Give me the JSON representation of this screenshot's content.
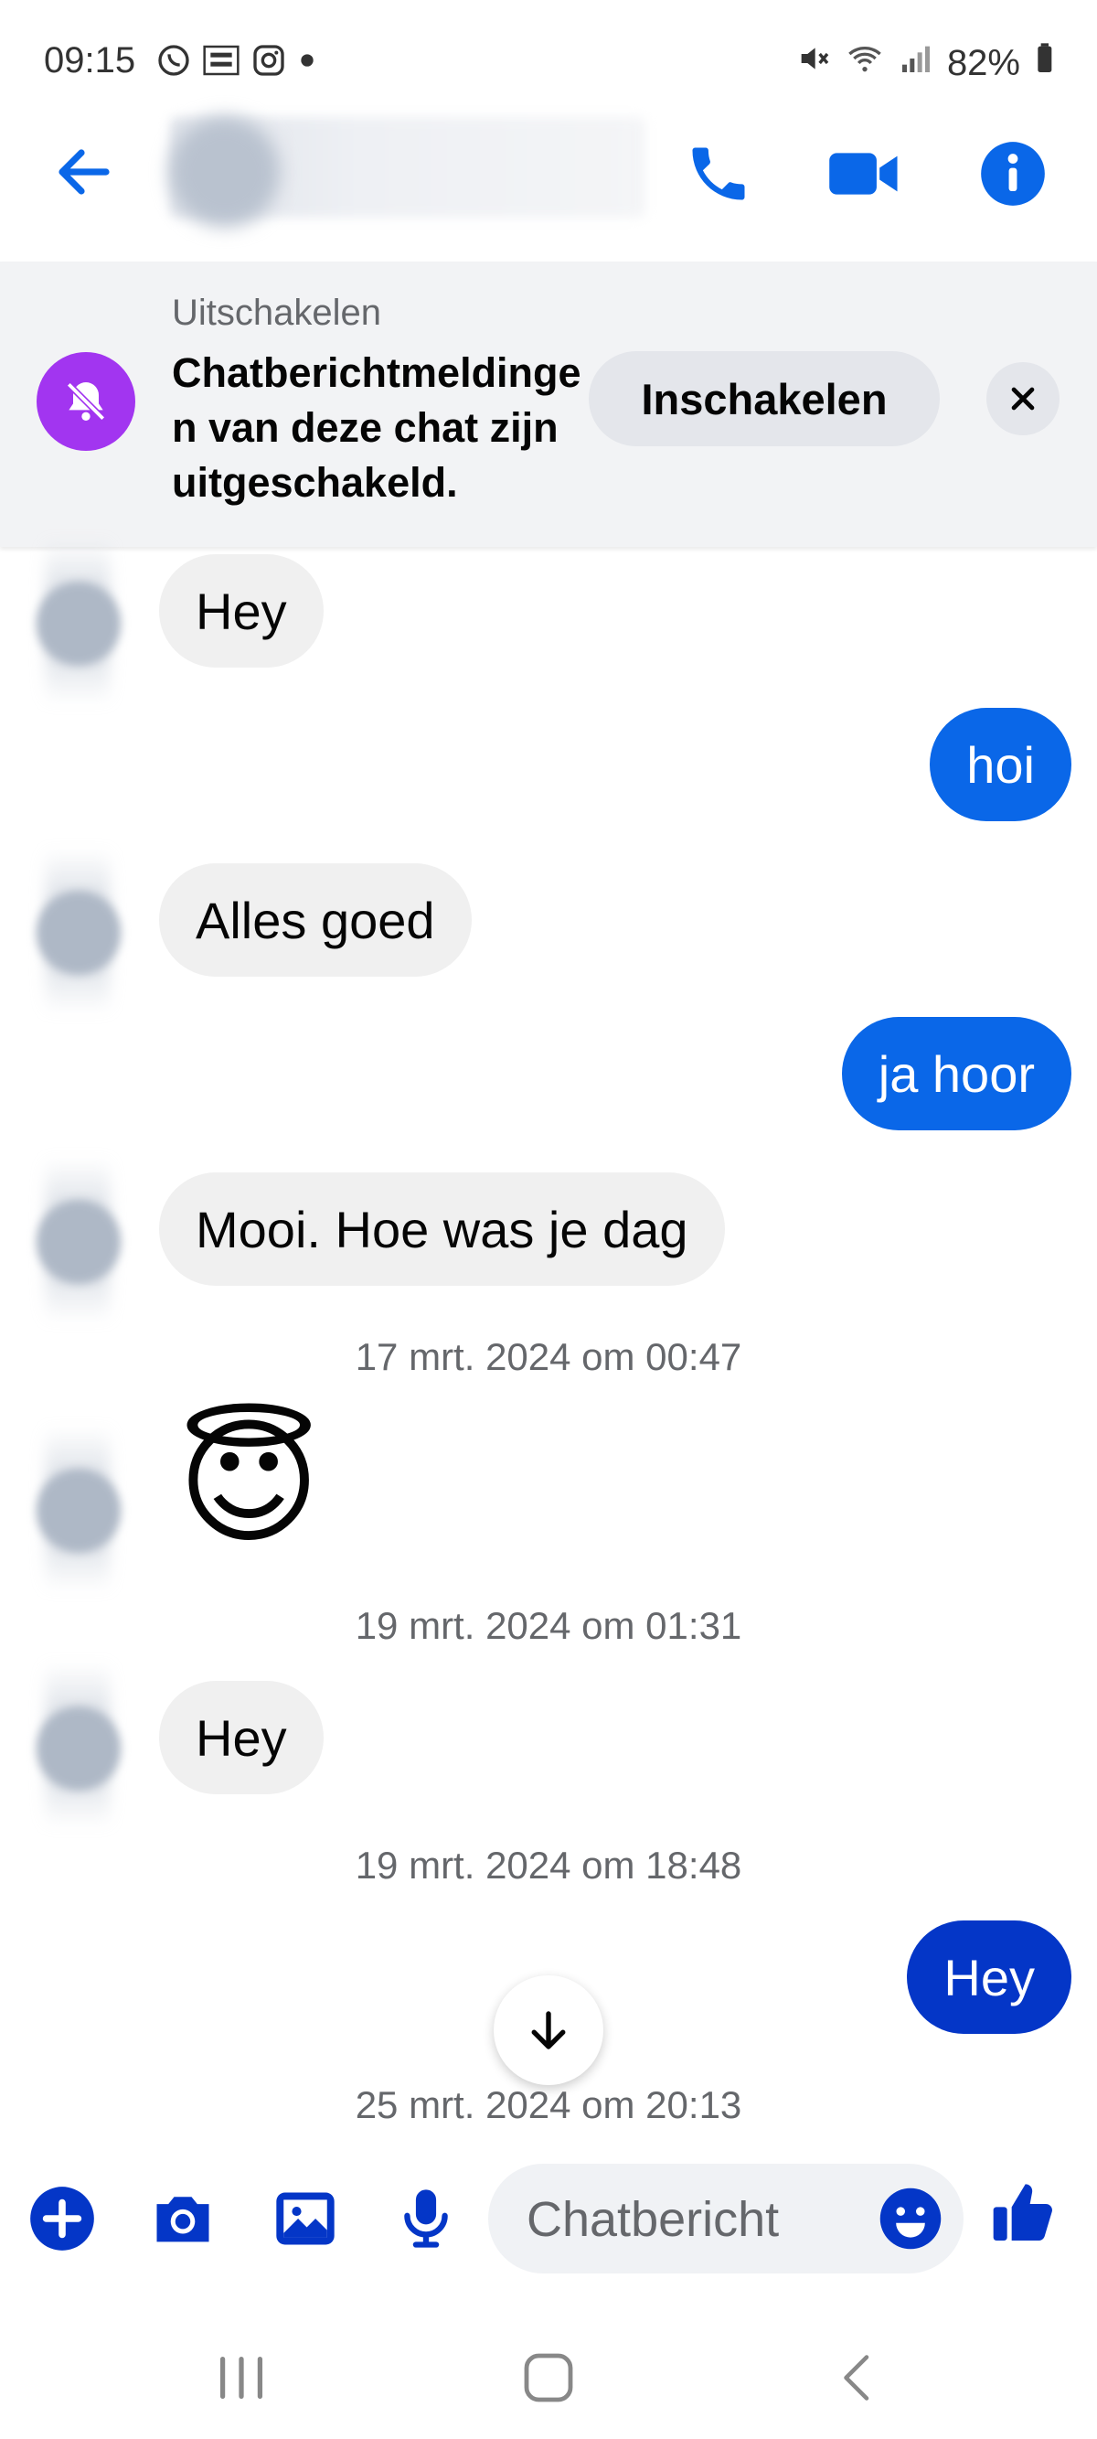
{
  "status_bar": {
    "time": "09:15",
    "battery": "82%",
    "icons": [
      "whatsapp-icon",
      "temu-icon",
      "instagram-icon",
      "dot-icon",
      "mute-icon",
      "wifi-icon",
      "signal-icon",
      "battery-icon"
    ]
  },
  "header": {
    "icons": [
      "back-arrow-icon",
      "phone-icon",
      "video-icon",
      "info-icon"
    ]
  },
  "banner": {
    "title": "Uitschakelen",
    "text": "Chatberichtmeldingen van deze chat zijn uitgeschakeld.",
    "button": "Inschakelen"
  },
  "messages": [
    {
      "side": "in",
      "text": "Hey"
    },
    {
      "side": "out",
      "text": "hoi"
    },
    {
      "side": "in",
      "text": "Alles goed"
    },
    {
      "side": "out",
      "text": "ja hoor"
    },
    {
      "side": "in",
      "text": "Mooi. Hoe was je dag"
    },
    {
      "side": "stamp",
      "text": "17 mrt. 2024 om 00:47"
    },
    {
      "side": "in",
      "text": "😇"
    },
    {
      "side": "stamp",
      "text": "19 mrt. 2024 om 01:31"
    },
    {
      "side": "in",
      "text": "Hey"
    },
    {
      "side": "stamp",
      "text": "19 mrt. 2024 om 18:48"
    },
    {
      "side": "out",
      "text": "Hey"
    },
    {
      "side": "stamp",
      "text": "25 mrt. 2024 om 20:13"
    }
  ],
  "composer": {
    "placeholder": "Chatbericht"
  },
  "colors": {
    "accent": "#0a67e8",
    "outgoing_dark": "#0436c7",
    "incoming_bubble": "#f0f0f0",
    "muted_purple": "#a235f0"
  }
}
